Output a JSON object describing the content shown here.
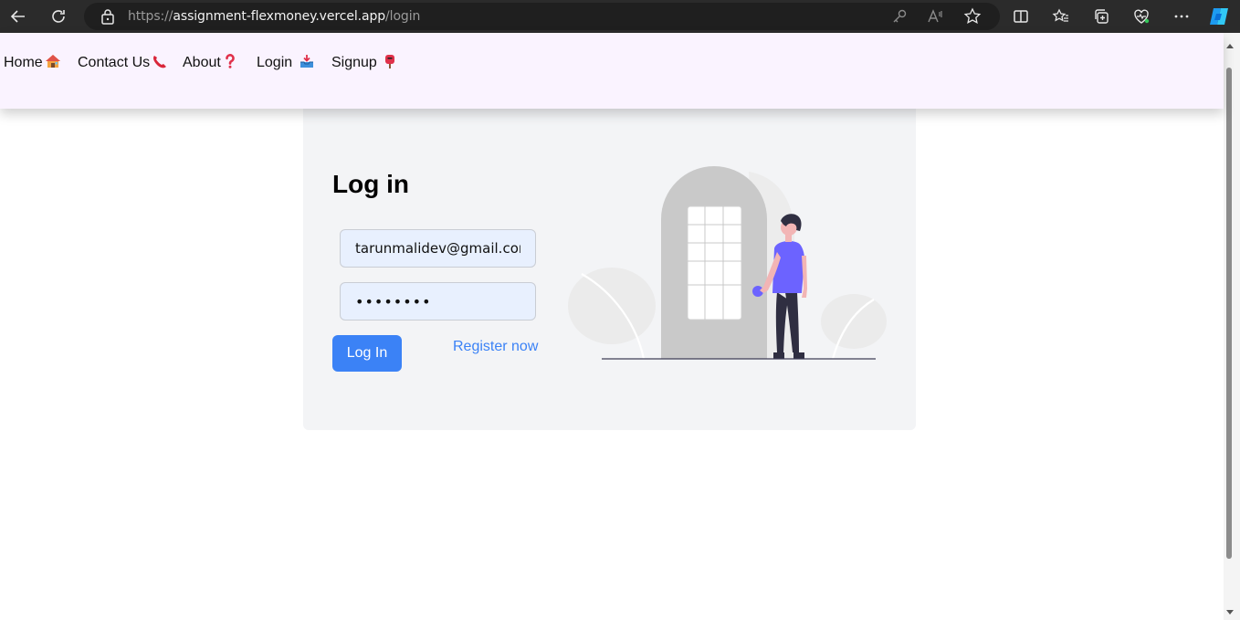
{
  "browser": {
    "url_scheme": "https://",
    "url_host": "assignment-flexmoney.vercel.app",
    "url_path": "/login"
  },
  "nav": {
    "items": [
      {
        "label": "Home",
        "icon": "house-emoji"
      },
      {
        "label": "Contact Us",
        "icon": "telephone-emoji"
      },
      {
        "label": "About",
        "icon": "question-mark-emoji"
      },
      {
        "label": "Login",
        "icon": "inbox-tray-emoji"
      },
      {
        "label": "Signup",
        "icon": "postbox-emoji"
      }
    ]
  },
  "login": {
    "title": "Log in",
    "email_value": "tarunmalidev@gmail.com",
    "password_value": "••••••••",
    "submit_label": "Log In",
    "register_label": "Register now"
  },
  "colors": {
    "accent": "#3b82f6",
    "nav_bg": "#faf3ff",
    "card_bg": "#f3f4f6",
    "illustration_person": "#6c63ff"
  }
}
